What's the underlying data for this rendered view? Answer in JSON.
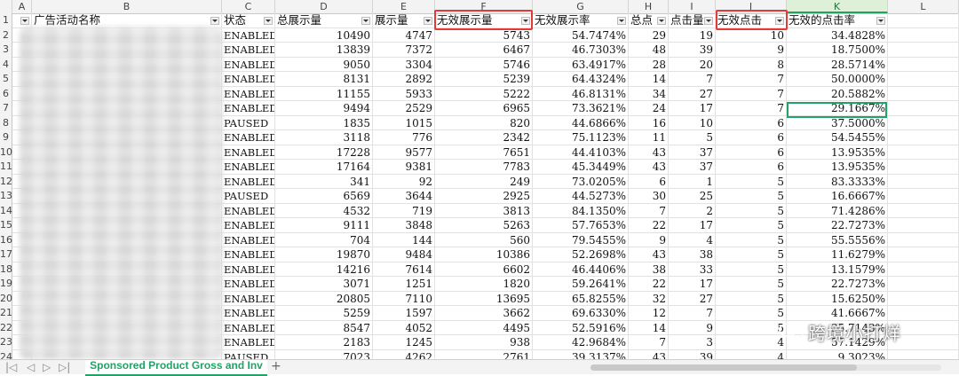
{
  "column_letters": [
    "A",
    "B",
    "C",
    "D",
    "E",
    "F",
    "G",
    "H",
    "I",
    "J",
    "K",
    "L"
  ],
  "selected_column": "K",
  "headers": [
    "广告活动名称",
    "状态",
    "总展示量",
    "展示量",
    "无效展示量",
    "无效展示率",
    "总点",
    "点击量",
    "无效点击",
    "无效的点击率"
  ],
  "row_numbers": [
    "1",
    "2",
    "3",
    "4",
    "5",
    "6",
    "7",
    "8",
    "9",
    "10",
    "11",
    "12",
    "13",
    "14",
    "15",
    "16",
    "17",
    "18",
    "19",
    "20",
    "21",
    "22",
    "23",
    "24"
  ],
  "rows": [
    [
      "ENABLED",
      "10490",
      "4747",
      "5743",
      "54.7474%",
      "29",
      "19",
      "10",
      "34.4828%"
    ],
    [
      "ENABLED",
      "13839",
      "7372",
      "6467",
      "46.7303%",
      "48",
      "39",
      "9",
      "18.7500%"
    ],
    [
      "ENABLED",
      "9050",
      "3304",
      "5746",
      "63.4917%",
      "28",
      "20",
      "8",
      "28.5714%"
    ],
    [
      "ENABLED",
      "8131",
      "2892",
      "5239",
      "64.4324%",
      "14",
      "7",
      "7",
      "50.0000%"
    ],
    [
      "ENABLED",
      "11155",
      "5933",
      "5222",
      "46.8131%",
      "34",
      "27",
      "7",
      "20.5882%"
    ],
    [
      "ENABLED",
      "9494",
      "2529",
      "6965",
      "73.3621%",
      "24",
      "17",
      "7",
      "29.1667%"
    ],
    [
      "PAUSED",
      "1835",
      "1015",
      "820",
      "44.6866%",
      "16",
      "10",
      "6",
      "37.5000%"
    ],
    [
      "ENABLED",
      "3118",
      "776",
      "2342",
      "75.1123%",
      "11",
      "5",
      "6",
      "54.5455%"
    ],
    [
      "ENABLED",
      "17228",
      "9577",
      "7651",
      "44.4103%",
      "43",
      "37",
      "6",
      "13.9535%"
    ],
    [
      "ENABLED",
      "17164",
      "9381",
      "7783",
      "45.3449%",
      "43",
      "37",
      "6",
      "13.9535%"
    ],
    [
      "ENABLED",
      "341",
      "92",
      "249",
      "73.0205%",
      "6",
      "1",
      "5",
      "83.3333%"
    ],
    [
      "PAUSED",
      "6569",
      "3644",
      "2925",
      "44.5273%",
      "30",
      "25",
      "5",
      "16.6667%"
    ],
    [
      "ENABLED",
      "4532",
      "719",
      "3813",
      "84.1350%",
      "7",
      "2",
      "5",
      "71.4286%"
    ],
    [
      "ENABLED",
      "9111",
      "3848",
      "5263",
      "57.7653%",
      "22",
      "17",
      "5",
      "22.7273%"
    ],
    [
      "ENABLED",
      "704",
      "144",
      "560",
      "79.5455%",
      "9",
      "4",
      "5",
      "55.5556%"
    ],
    [
      "ENABLED",
      "19870",
      "9484",
      "10386",
      "52.2698%",
      "43",
      "38",
      "5",
      "11.6279%"
    ],
    [
      "ENABLED",
      "14216",
      "7614",
      "6602",
      "46.4406%",
      "38",
      "33",
      "5",
      "13.1579%"
    ],
    [
      "ENABLED",
      "3071",
      "1251",
      "1820",
      "59.2641%",
      "22",
      "17",
      "5",
      "22.7273%"
    ],
    [
      "ENABLED",
      "20805",
      "7110",
      "13695",
      "65.8255%",
      "32",
      "27",
      "5",
      "15.6250%"
    ],
    [
      "ENABLED",
      "5259",
      "1597",
      "3662",
      "69.6330%",
      "12",
      "7",
      "5",
      "41.6667%"
    ],
    [
      "ENABLED",
      "8547",
      "4052",
      "4495",
      "52.5916%",
      "14",
      "9",
      "5",
      "35.7143%"
    ],
    [
      "ENABLED",
      "2183",
      "1245",
      "938",
      "42.9684%",
      "7",
      "3",
      "4",
      "57.1429%"
    ],
    [
      "PAUSED",
      "7023",
      "4262",
      "2761",
      "39.3137%",
      "43",
      "39",
      "4",
      "9.3023%"
    ]
  ],
  "sheet_tab": "Sponsored Product Gross and Inv",
  "add_sheet": "+",
  "watermark": "跨境小打烊",
  "accent_color": "#21a366",
  "highlight_color": "#e53935"
}
